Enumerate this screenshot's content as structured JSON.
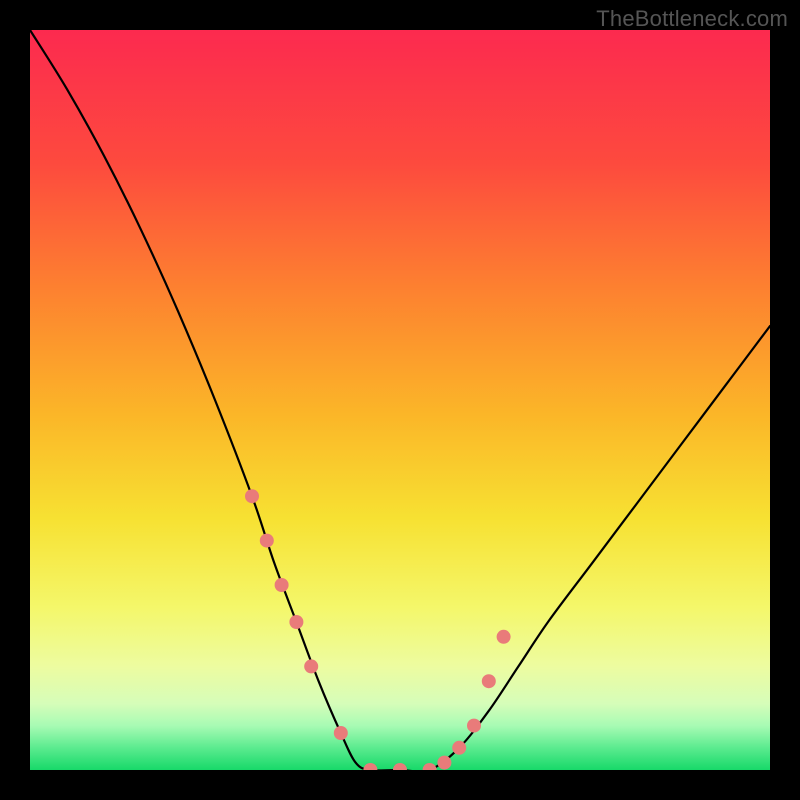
{
  "watermark": "TheBottleneck.com",
  "chart_data": {
    "type": "line",
    "title": "",
    "xlabel": "",
    "ylabel": "",
    "xlim": [
      0,
      100
    ],
    "ylim": [
      0,
      100
    ],
    "series": [
      {
        "name": "bottleneck-curve",
        "x": [
          0,
          5,
          10,
          15,
          20,
          25,
          30,
          33,
          36,
          39,
          42,
          44,
          46,
          50,
          54,
          58,
          62,
          66,
          70,
          76,
          82,
          88,
          94,
          100
        ],
        "values": [
          100,
          92,
          83,
          73,
          62,
          50,
          37,
          28,
          20,
          12,
          5,
          1,
          0,
          0,
          0,
          3,
          8,
          14,
          20,
          28,
          36,
          44,
          52,
          60
        ]
      }
    ],
    "markers": {
      "name": "highlight-dots",
      "color": "#e97b7a",
      "x": [
        30,
        32,
        34,
        36,
        38,
        42,
        46,
        50,
        54,
        56,
        58,
        60,
        62,
        64
      ],
      "values": [
        37,
        31,
        25,
        20,
        14,
        5,
        0,
        0,
        0,
        1,
        3,
        6,
        12,
        18
      ]
    },
    "gradient_stops": [
      {
        "offset": 0,
        "color": "#fc2a4f"
      },
      {
        "offset": 18,
        "color": "#fd4a3e"
      },
      {
        "offset": 35,
        "color": "#fd8130"
      },
      {
        "offset": 52,
        "color": "#fbb628"
      },
      {
        "offset": 66,
        "color": "#f7e132"
      },
      {
        "offset": 78,
        "color": "#f4f76a"
      },
      {
        "offset": 86,
        "color": "#edfca0"
      },
      {
        "offset": 91,
        "color": "#d6fdb9"
      },
      {
        "offset": 94,
        "color": "#a8fbb4"
      },
      {
        "offset": 97,
        "color": "#5beb8f"
      },
      {
        "offset": 100,
        "color": "#17d969"
      }
    ],
    "green_strip_height_pct": 7.5
  }
}
